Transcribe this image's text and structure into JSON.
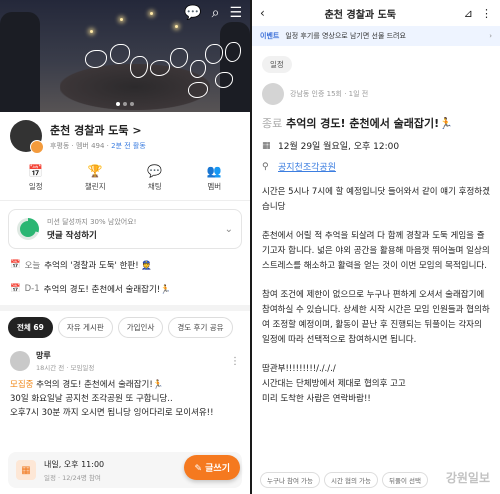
{
  "left": {
    "club": {
      "name": "춘천 경찰과 도둑 >",
      "meta_prefix": "후평동 · 멤버 494 · ",
      "meta_active": "2분 전 활동"
    },
    "menu": [
      {
        "icon": "📅",
        "label": "일정"
      },
      {
        "icon": "🏆",
        "label": "챌린지"
      },
      {
        "icon": "💬",
        "label": "채팅"
      },
      {
        "icon": "👥",
        "label": "멤버"
      }
    ],
    "mission": {
      "progress": 0.3,
      "line1": "미션 달성까지 30% 남았어요!",
      "line2": "댓글 작성하기"
    },
    "notices": [
      {
        "tag": "오늘",
        "text": "추억의 '경찰과 도둑' 한판! 👮",
        "right": ""
      },
      {
        "tag": "D-1",
        "text": "추억의 경도! 춘천에서 술래잡기!🏃",
        "right": ""
      }
    ],
    "tabs": [
      "전체 69",
      "자유 게시판",
      "가입인사",
      "경도 후기 공유"
    ],
    "post": {
      "name": "망루",
      "sub": "18시간 전 · 모임일정",
      "recruit": "모집중",
      "title": " 추억의 경도! 춘천에서 술래잡기!🏃",
      "line2": "30일 화요일날 공지천 조각공원 또 구합니당..",
      "line3": "오후7시 30분 까지 오시면 됩니당  잉어다리로 모이셔유!!"
    },
    "event": {
      "d1": "내일, 오후 11:00",
      "d2": "일정 · 12/24명 참여"
    },
    "write_label": "글쓰기"
  },
  "right": {
    "header_title": "춘천 경찰과 도둑",
    "banner": {
      "tag": "이벤트",
      "text": "일정 후기를 영상으로 남기면 선물 드려요"
    },
    "chip": "일정",
    "author_meta": "강남동 인증 15회 · 1일 전",
    "title_status": "종료",
    "title": " 추억의 경도! 춘천에서 술래잡기!🏃",
    "date": "12월 29일 월요일, 오후 12:00",
    "place": "공지천조각공원",
    "paragraphs": [
      "시간은 5시나 7시에 할 예정입니닷 들어와서 같이 얘기 후정하겠습니당",
      "춘천에서 어릴 적 추억을 되살려 다 함께 경찰과 도둑 게임을 즐기고자 합니다. 넓은 야외 공간을 활용해 마음껏 뛰어놀며 일상의 스트레스를 해소하고 활력을 얻는 것이 이번 모임의 목적입니다.",
      "참여 조건에 제한이 없으므로 누구나 편하게 오셔서 술래잡기에 참여하실 수 있습니다. 상세한 시작 시간은 모임 인원들과 협의하여 조정할 예정이며, 활동이 끝난 후 진행되는 뒤풀이는 각자의 일정에 따라 선택적으로 참여하시면 됩니다.",
      "땀관부!!!!!!!!!/./././",
      "시간대는 단체방에서 제대로 협의후 고고",
      "미리 도착한 사람은 연락바람!!"
    ],
    "tags": [
      "누구나 참여 가능",
      "시간 협의 가능",
      "뒤풀이 선택"
    ],
    "watermark": "강원일보"
  }
}
